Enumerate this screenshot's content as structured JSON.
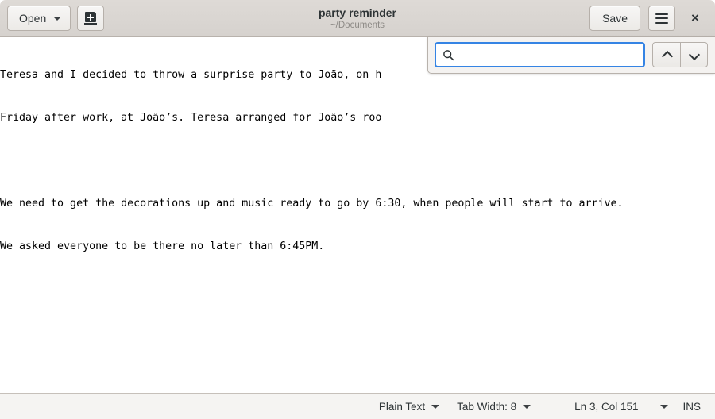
{
  "window": {
    "title": "party reminder",
    "subtitle": "~/Documents"
  },
  "header": {
    "open_label": "Open",
    "open_caret_icon": "chevron-down-icon",
    "new_document_icon": "new-document-icon",
    "save_label": "Save",
    "menu_icon": "hamburger-menu-icon",
    "close_label": "×"
  },
  "search": {
    "icon": "search-icon",
    "value": "",
    "placeholder": "",
    "prev_icon": "chevron-up-icon",
    "next_icon": "chevron-down-icon",
    "focus_color": "#3584e4"
  },
  "editor": {
    "lines": [
      "Teresa and I decided to throw a surprise party to João, on h",
      "Friday after work, at João’s. Teresa arranged for João’s roo",
      "",
      "We need to get the decorations up and music ready to go by 6:30, when people will start to arrive.",
      "We asked everyone to be there no later than 6:45PM."
    ]
  },
  "statusbar": {
    "language": "Plain Text",
    "language_caret_icon": "chevron-down-icon",
    "tab_width": "Tab Width: 8",
    "tab_width_caret_icon": "chevron-down-icon",
    "cursor_position": "Ln 3, Col 151",
    "cursor_caret_icon": "chevron-down-icon",
    "insert_mode": "INS"
  }
}
